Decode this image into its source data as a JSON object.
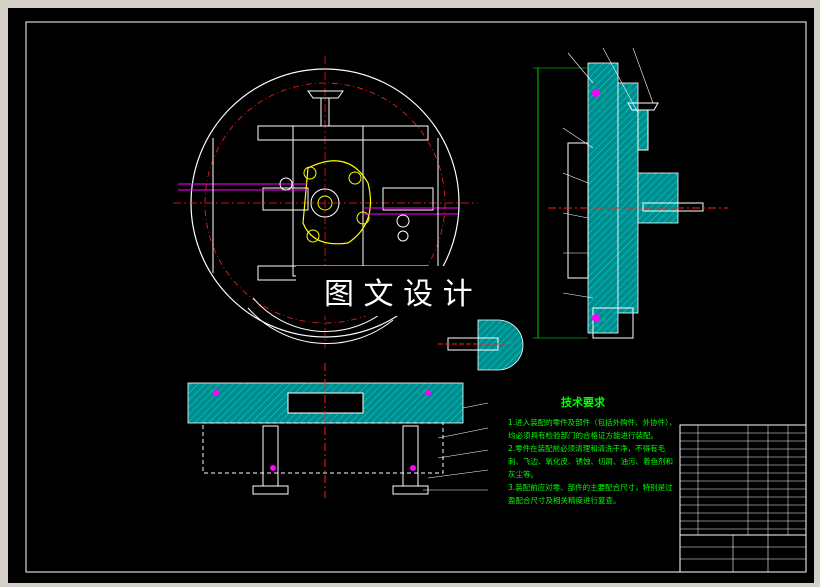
{
  "watermark": "图 文 设 计",
  "technical_requirements": {
    "title": "技术要求",
    "items": [
      "1.进入装配的零件及部件（包括外购件、外协件），均必须具有检验部门的合格证方能进行装配。",
      "2.零件在装配前必须清理和清洗干净，不得有毛刺、飞边、氧化皮、锈蚀、切屑、油污、着色剂和灰尘等。",
      "3.装配前应对零、部件的主要配合尺寸，特别是过盈配合尺寸及相关精度进行复查。"
    ]
  },
  "colors": {
    "background": "#000000",
    "frame": "#d4d0c8",
    "lines": "#ffffff",
    "centerline": "#ff2020",
    "dimension": "#00ff00",
    "section": "#00a0a0",
    "magenta": "#ff00ff",
    "yellow": "#ffff00"
  }
}
